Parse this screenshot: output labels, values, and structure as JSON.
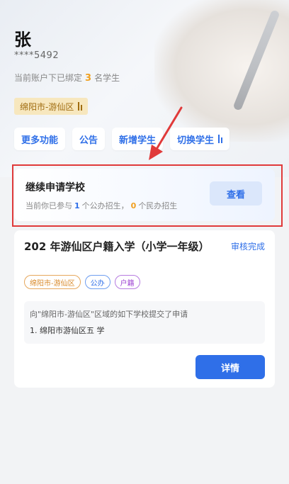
{
  "user": {
    "name": "张",
    "phone": "****5492",
    "bind_prefix": "当前账户下已绑定",
    "bind_count": "3",
    "bind_suffix": "名学生",
    "region": "绵阳市-游仙区"
  },
  "actions": {
    "more": "更多功能",
    "notice": "公告",
    "add_student": "新增学生",
    "switch_student": "切换学生"
  },
  "continue_card": {
    "title": "继续申请学校",
    "sub_prefix": "当前你已参与",
    "public_count": "1",
    "sub_mid": "个公办招生，",
    "private_count": "0",
    "sub_suffix": "个民办招生",
    "view_label": "查看"
  },
  "application": {
    "title": "202  年游仙区户籍入学（小学一年级）",
    "status": "审核完成",
    "tags": [
      "绵阳市-游仙区",
      "公办",
      "户籍"
    ],
    "school_desc": "向\"绵阳市-游仙区\"区域的如下学校提交了申请",
    "school_item": "1. 绵阳市游仙区五          学",
    "detail_label": "详情"
  },
  "colors": {
    "accent": "#2f6fe8",
    "highlight": "#e03a3a",
    "count": "#f0a020"
  }
}
